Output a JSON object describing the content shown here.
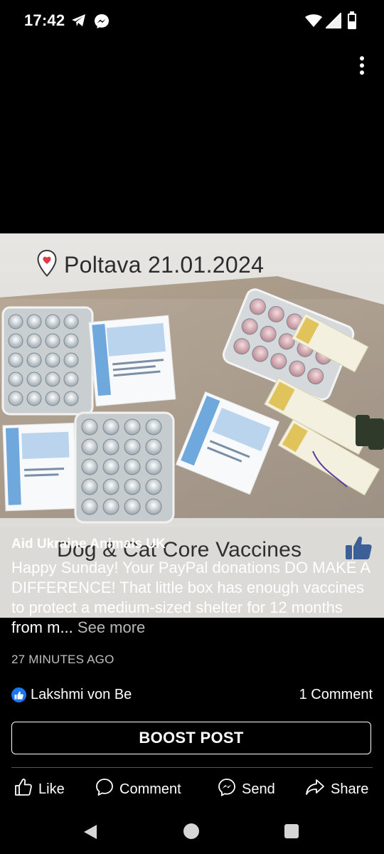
{
  "status_bar": {
    "time": "17:42",
    "icons": [
      "telegram-icon",
      "messenger-icon",
      "wifi-icon",
      "signal-icon",
      "battery-icon"
    ]
  },
  "photo": {
    "stamp": "Poltava 21.01.2024",
    "caption": "Dog & Cat Core Vaccines",
    "box_labels": [
      "Біокан DHPPi + L",
      "Biocan DHPPi + L",
      "Біокан DHPPi + L",
      "Biocan DHPPi + L",
      "Біокан Biocan DHPPi + L",
      "Біокан PCH Biocan PCH",
      "Біокан PCH Biocan PCH"
    ]
  },
  "post": {
    "page_name": "Aid Ukraine Animals UK",
    "body": "Happy Sunday! Your PayPal donations DO MAKE A DIFFERENCE!  That little box has enough vaccines to protect a medium-sized shelter for 12 months from m...",
    "see_more": "See more",
    "timestamp": "27 MINUTES AGO"
  },
  "engagement": {
    "reaction_names": "Lakshmi von Be",
    "comment_count": "1 Comment"
  },
  "boost": {
    "label": "BOOST POST"
  },
  "actions": {
    "like": "Like",
    "comment": "Comment",
    "send": "Send",
    "share": "Share"
  },
  "colors": {
    "background": "#000000",
    "like_blue": "#1877f2",
    "secondary_text": "#bfbfbf"
  }
}
